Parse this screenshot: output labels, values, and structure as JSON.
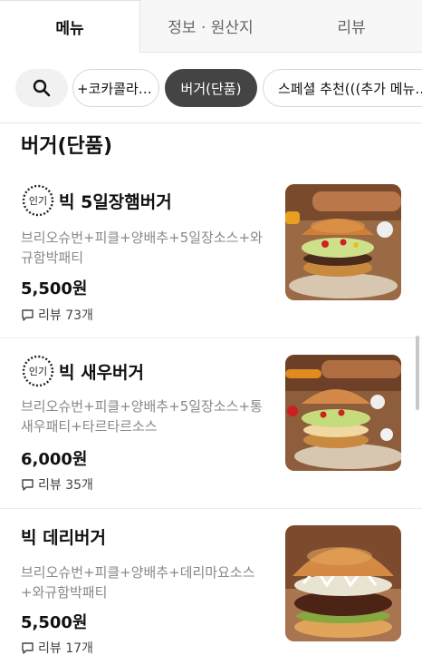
{
  "tabs": [
    {
      "label": "메뉴",
      "active": true
    },
    {
      "label": "정보 · 원산지",
      "active": false
    },
    {
      "label": "리뷰",
      "active": false
    }
  ],
  "chips": [
    {
      "label": "+코카콜라…",
      "selected": false
    },
    {
      "label": "버거(단품)",
      "selected": true
    },
    {
      "label": "스페셜 추천(((추가 메뉴…",
      "selected": false
    }
  ],
  "section_title": "버거(단품)",
  "badge_label": "인기",
  "items": [
    {
      "name": "빅 5일장햄버거",
      "popular": true,
      "desc": "브리오슈번+피클+양배추+5일장소스+와규함박패티",
      "price": "5,500원",
      "review": "리뷰 73개"
    },
    {
      "name": "빅 새우버거",
      "popular": true,
      "desc": "브리오슈번+피클+양배추+5일장소스+통새우패티+타르타르소스",
      "price": "6,000원",
      "review": "리뷰 35개"
    },
    {
      "name": "빅 데리버거",
      "popular": false,
      "desc": "브리오슈번+피클+양배추+데리마요소스+와규함박패티",
      "price": "5,500원",
      "review": "리뷰 17개"
    }
  ],
  "colors": {
    "selected_chip": "#444444",
    "badge": "#222222"
  }
}
